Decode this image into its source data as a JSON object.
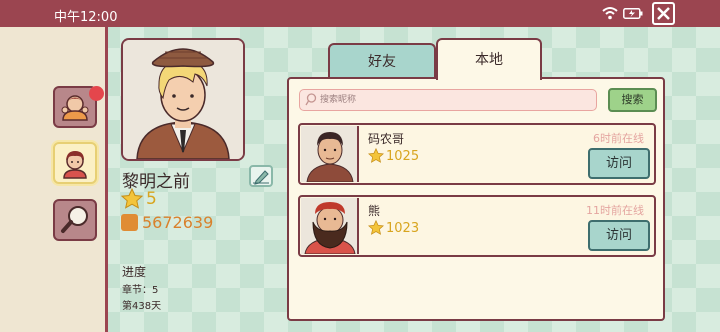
{
  "status_bar": {
    "time": "中午12:00",
    "wifi_icon": "wifi-icon",
    "battery_icon": "battery-icon",
    "close_icon": "close-icon"
  },
  "nav": {
    "items": [
      {
        "icon": "person-notification-icon",
        "has_badge": true
      },
      {
        "icon": "avatar-face-icon",
        "active": true
      },
      {
        "icon": "magnifier-icon"
      }
    ]
  },
  "profile": {
    "name": "黎明之前",
    "level": "5",
    "coins": "5672639",
    "progress_title": "进度",
    "chapter": "章节：5",
    "day": "第438天"
  },
  "tabs": [
    {
      "label": "好友",
      "active": false
    },
    {
      "label": "本地",
      "active": true
    }
  ],
  "search": {
    "placeholder": "搜索昵称",
    "button_label": "搜索"
  },
  "friends": [
    {
      "name": "码农哥",
      "score": "1025",
      "status": "6时前在线",
      "button_label": "访问"
    },
    {
      "name": "熊",
      "score": "1023",
      "status": "11时前在线",
      "button_label": "访问"
    }
  ],
  "colors": {
    "accent": "#9b4550",
    "panel": "#fdf8e7",
    "star": "#d8a51f",
    "coin": "#d9812c",
    "button_green": "#9ed28a",
    "button_teal": "#a8d5cc"
  }
}
